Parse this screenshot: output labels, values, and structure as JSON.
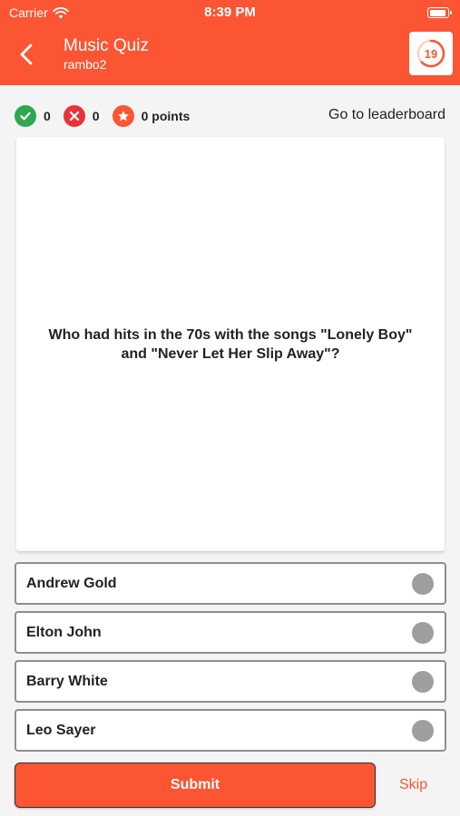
{
  "status_bar": {
    "carrier": "Carrier",
    "time": "8:39 PM"
  },
  "header": {
    "title": "Music Quiz",
    "subtitle": "rambo2",
    "timer": "19",
    "timer_fraction": 0.63
  },
  "stats": {
    "correct": "0",
    "wrong": "0",
    "points": "0 points",
    "leaderboard_label": "Go to leaderboard"
  },
  "question": {
    "text": "Who had hits in the 70s with the songs \"Lonely Boy\" and \"Never Let Her Slip Away\"?"
  },
  "answers": [
    {
      "label": "Andrew Gold"
    },
    {
      "label": "Elton John"
    },
    {
      "label": "Barry White"
    },
    {
      "label": "Leo Sayer"
    }
  ],
  "actions": {
    "submit_label": "Submit",
    "skip_label": "Skip"
  },
  "colors": {
    "accent": "#fb5533",
    "correct": "#2fa84f",
    "wrong": "#e8333a",
    "points": "#fb5533"
  }
}
